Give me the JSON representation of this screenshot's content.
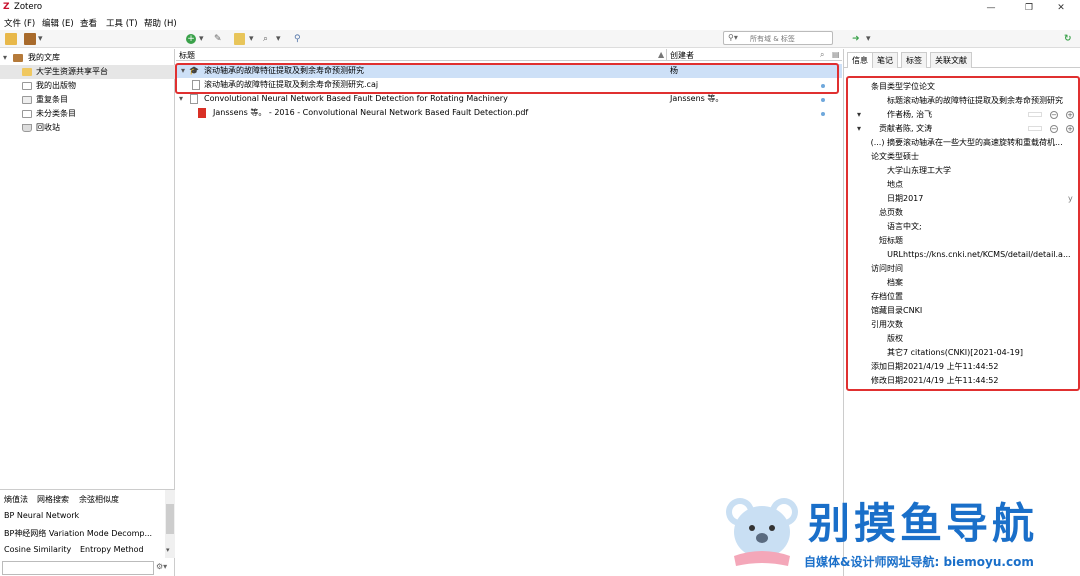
{
  "window": {
    "title": "Zotero",
    "logo": "Z"
  },
  "menu": [
    "文件 (F)",
    "编辑 (E)",
    "查看",
    "工具 (T)",
    "帮助 (H)"
  ],
  "search": {
    "placeholder": "所有域 & 标签"
  },
  "library": [
    {
      "label": "我的文库",
      "icon": "library-icon"
    },
    {
      "label": "大学生资源共享平台",
      "icon": "folder-icon"
    },
    {
      "label": "我的出版物",
      "icon": "publications-icon"
    },
    {
      "label": "重复条目",
      "icon": "duplicates-icon"
    },
    {
      "label": "未分类条目",
      "icon": "unfiled-icon"
    },
    {
      "label": "回收站",
      "icon": "trash-icon"
    }
  ],
  "tags": {
    "rows": [
      "熵值法",
      "网格搜索",
      "余弦相似度",
      "BP Neural Network",
      "BP神经网络 Variation Mode Decomp...",
      "Cosine Similarity",
      "Entropy Method"
    ]
  },
  "columns": {
    "title": "标题",
    "creator": "创建者"
  },
  "items": [
    {
      "title": "滚动轴承的故障特征提取及剩余寿命预测研究",
      "creator": "杨"
    },
    {
      "title": "滚动轴承的故障特征提取及剩余寿命预测研究.caj",
      "creator": ""
    },
    {
      "title": "Convolutional Neural Network Based Fault Detection for Rotating Machinery",
      "creator": "Janssens 等。"
    },
    {
      "title": "Janssens 等。 - 2016 - Convolutional Neural Network Based Fault Detection.pdf",
      "creator": ""
    }
  ],
  "tabs": [
    "信息",
    "笔记",
    "标签",
    "关联文献"
  ],
  "fields": [
    {
      "label": "条目类型",
      "value": "学位论文"
    },
    {
      "label": "标题",
      "value": "滚动轴承的故障特征提取及剩余寿命预测研究"
    },
    {
      "label": "作者",
      "value": "杨, 治飞"
    },
    {
      "label": "贡献者",
      "value": "陈, 文涛"
    },
    {
      "label": "(...) 摘要",
      "value": "滚动轴承在一些大型的高速旋转和重载荷机..."
    },
    {
      "label": "论文类型",
      "value": "硕士"
    },
    {
      "label": "大学",
      "value": "山东理工大学"
    },
    {
      "label": "地点",
      "value": ""
    },
    {
      "label": "日期",
      "value": "2017"
    },
    {
      "label": "总页数",
      "value": ""
    },
    {
      "label": "语言",
      "value": "中文;"
    },
    {
      "label": "短标题",
      "value": ""
    },
    {
      "label": "URL",
      "value": "https://kns.cnki.net/KCMS/detail/detail.a..."
    },
    {
      "label": "访问时间",
      "value": ""
    },
    {
      "label": "档案",
      "value": ""
    },
    {
      "label": "存档位置",
      "value": ""
    },
    {
      "label": "馆藏目录",
      "value": "CNKI"
    },
    {
      "label": "引用次数",
      "value": ""
    },
    {
      "label": "版权",
      "value": ""
    },
    {
      "label": "其它",
      "value": "7 citations(CNKI)[2021-04-19]"
    },
    {
      "label": "添加日期",
      "value": "2021/4/19 上午11:44:52"
    },
    {
      "label": "修改日期",
      "value": "2021/4/19 上午11:44:52"
    }
  ],
  "date_suffix": "y",
  "watermark": {
    "title": "别摸鱼导航",
    "subtitle": "自媒体&设计师网址导航: biemoyu.com"
  },
  "colors": {
    "accent": "#e03030",
    "selection": "#cde0f7",
    "brand": "#1a6fc9"
  }
}
